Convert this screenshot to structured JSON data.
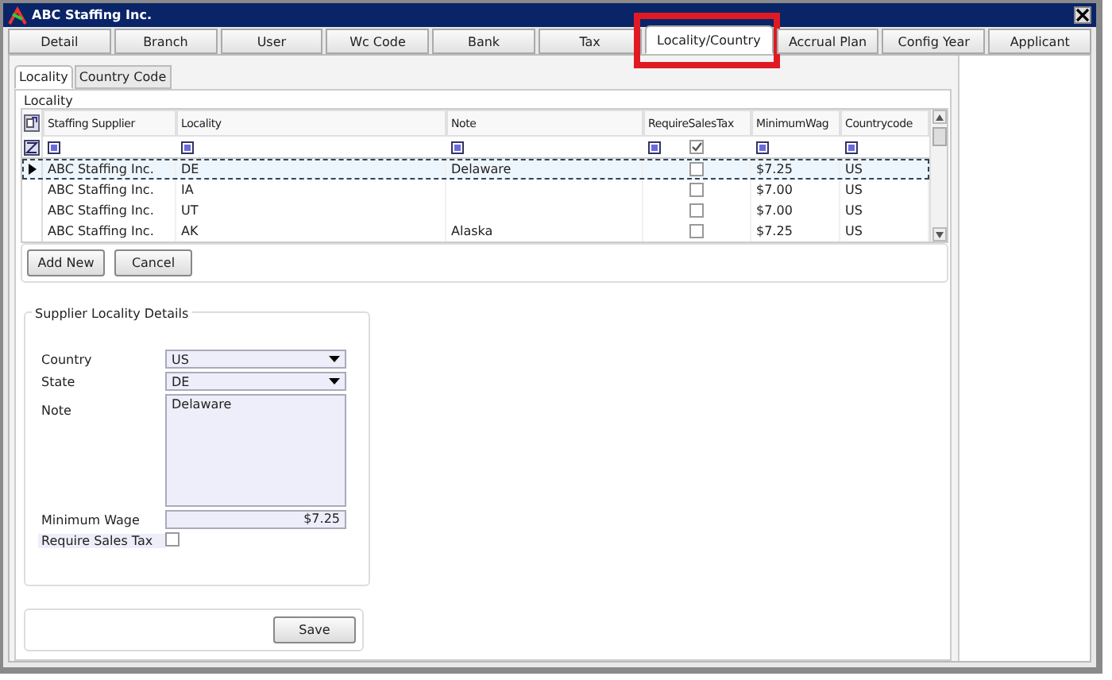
{
  "window": {
    "title": "ABC Staffing Inc."
  },
  "tabs": [
    {
      "label": "Detail",
      "selected": false,
      "highlighted": false
    },
    {
      "label": "Branch",
      "selected": false,
      "highlighted": false
    },
    {
      "label": "User",
      "selected": false,
      "highlighted": false
    },
    {
      "label": "Wc Code",
      "selected": false,
      "highlighted": false
    },
    {
      "label": "Bank",
      "selected": false,
      "highlighted": false
    },
    {
      "label": "Tax",
      "selected": false,
      "highlighted": false
    },
    {
      "label": "Locality/Country",
      "selected": true,
      "highlighted": true
    },
    {
      "label": "Accrual Plan",
      "selected": false,
      "highlighted": false
    },
    {
      "label": "Config Year",
      "selected": false,
      "highlighted": false
    },
    {
      "label": "Applicant",
      "selected": false,
      "highlighted": false
    }
  ],
  "subtabs": [
    {
      "label": "Locality",
      "selected": true
    },
    {
      "label": "Country Code",
      "selected": false
    }
  ],
  "locality_group": {
    "title": "Locality",
    "columns": [
      "Staffing Supplier",
      "Locality",
      "Note",
      "RequireSalesTax",
      "MinimumWag",
      "Countrycode"
    ],
    "filter_require_sales_tax": true,
    "rows": [
      {
        "selected": true,
        "supplier": "ABC Staffing Inc.",
        "locality": "DE",
        "note": "Delaware",
        "require_sales_tax": false,
        "minimum_wage": "$7.25",
        "countrycode": "US"
      },
      {
        "selected": false,
        "supplier": "ABC Staffing Inc.",
        "locality": "IA",
        "note": "",
        "require_sales_tax": false,
        "minimum_wage": "$7.00",
        "countrycode": "US"
      },
      {
        "selected": false,
        "supplier": "ABC Staffing Inc.",
        "locality": "UT",
        "note": "",
        "require_sales_tax": false,
        "minimum_wage": "$7.00",
        "countrycode": "US"
      },
      {
        "selected": false,
        "supplier": "ABC Staffing Inc.",
        "locality": "AK",
        "note": "Alaska",
        "require_sales_tax": false,
        "minimum_wage": "$7.25",
        "countrycode": "US"
      }
    ],
    "buttons": [
      "Add New",
      "Cancel"
    ]
  },
  "details": {
    "title": "Supplier Locality Details",
    "country": {
      "label": "Country",
      "value": "US"
    },
    "state": {
      "label": "State",
      "value": "DE"
    },
    "note": {
      "label": "Note",
      "value": "Delaware"
    },
    "minimum_wage": {
      "label": "Minimum Wage",
      "value": "$7.25"
    },
    "require_sales_tax": {
      "label": "Require Sales Tax",
      "checked": false
    }
  },
  "save_button": "Save"
}
